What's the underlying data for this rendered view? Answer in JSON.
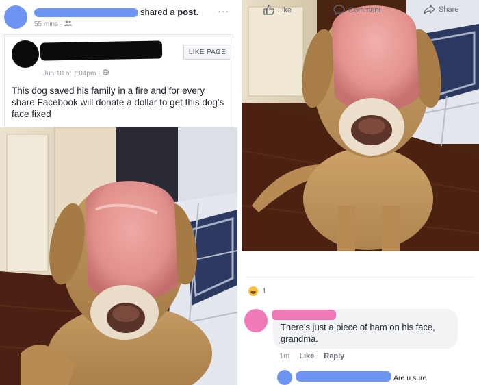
{
  "share_header": {
    "action_text": "shared a ",
    "action_bold": "post.",
    "time": "55 mins",
    "more": "···"
  },
  "original_post": {
    "like_page": "LIKE PAGE",
    "time": "Jun 18 at 7:04pm",
    "text": "This dog saved his family in a fire and for every share Facebook will donate a dollar to get this dog's face fixed"
  },
  "actions": {
    "like": "Like",
    "comment": "Comment",
    "share": "Share"
  },
  "reactions": {
    "count": "1",
    "icon": "haha-reaction-icon"
  },
  "comment": {
    "text": "There's just a piece of ham on his face, grandma.",
    "time": "1m",
    "like": "Like",
    "reply": "Reply"
  },
  "reply": {
    "text": "Are u sure"
  },
  "colors": {
    "redaction_blue": "#6f95f2",
    "redaction_pink": "#f07ab8",
    "redaction_black": "#0b0b0b",
    "fb_gray_text": "#606770"
  }
}
